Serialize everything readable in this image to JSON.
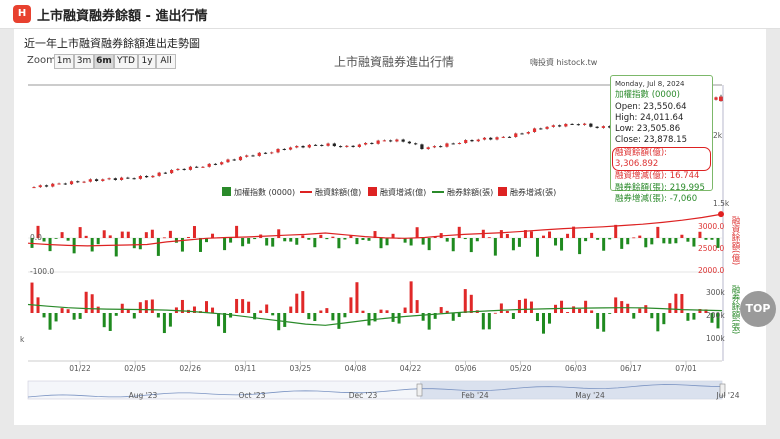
{
  "app": {
    "logo_text": "H",
    "title": "上市融資融券餘額 - 進出行情"
  },
  "section_title": "近一年上市融資融券餘額進出走勢圖",
  "zoom": {
    "label": "Zoom",
    "buttons": [
      "1m",
      "3m",
      "6m",
      "YTD",
      "1y",
      "All"
    ],
    "selected": "6m"
  },
  "chart_title": "上市融資融券進出行情",
  "credit": "嗨投資 histock.tw",
  "tooltip": {
    "date": "Monday, Jul 8, 2024",
    "series_name": "加權指數 (0000)",
    "open": "Open: 23,550.64",
    "high": "High: 24,011.64",
    "low": "Low: 23,505.86",
    "close": "Close: 23,878.15",
    "margin_balance": "融資餘額(億): 3,306.892",
    "margin_change": "融資增減(億): 16.744",
    "short_balance": "融券餘額(張): 219,995",
    "short_change": "融券增減(張): -7,060"
  },
  "legend": [
    {
      "label": "加權指數 (0000)",
      "kind": "box",
      "color": "#2a8a2a"
    },
    {
      "label": "融資餘額(億)",
      "kind": "line",
      "color": "#d22"
    },
    {
      "label": "融資增減(億)",
      "kind": "box",
      "color": "#d22"
    },
    {
      "label": "融券餘額(張)",
      "kind": "line",
      "color": "#2a8a2a"
    },
    {
      "label": "融券增減(張)",
      "kind": "box",
      "color": "#d22"
    }
  ],
  "axis_labels": {
    "price_right": [
      "2k",
      "1.5k"
    ],
    "margin_left": [
      "0.0",
      "-100.0"
    ],
    "margin_right": [
      "3000.0",
      "2500.0",
      "2000.0"
    ],
    "margin_title": "融資餘額(億)",
    "short_left": "k",
    "short_right": [
      "300k",
      "200k",
      "100k"
    ],
    "short_title": "融券餘額(張)"
  },
  "x_ticks": [
    "01/22",
    "02/05",
    "02/26",
    "03/11",
    "03/25",
    "04/08",
    "04/22",
    "05/06",
    "05/20",
    "06/03",
    "06/17",
    "07/01"
  ],
  "navigator_ticks": [
    "Aug '23",
    "Oct '23",
    "Dec '23",
    "Feb '24",
    "May '24",
    "Jul '24"
  ],
  "top_button": "TOP",
  "chart_data": {
    "type": "candlestick-combo",
    "x_range": [
      "2024-01-10",
      "2024-07-08"
    ],
    "last_point": {
      "date": "2024-07-08",
      "open": 23550.64,
      "high": 24011.64,
      "low": 23505.86,
      "close": 23878.15,
      "margin_balance": 3306.892,
      "margin_change": 16.744,
      "short_balance": 219995,
      "short_change": -7060
    },
    "index_close_trend": [
      17300,
      17500,
      17650,
      17800,
      17900,
      17950,
      18100,
      18500,
      18700,
      18900,
      19250,
      19600,
      19800,
      20150,
      20300,
      20400,
      20200,
      20450,
      20700,
      20650,
      20100,
      20350,
      20600,
      20800,
      20900,
      21200,
      21600,
      21800,
      21900,
      21600,
      21800,
      22300,
      22650,
      22900,
      23200,
      23878
    ],
    "margin_balance_trend": [
      2650,
      2620,
      2600,
      2590,
      2600,
      2610,
      2620,
      2680,
      2720,
      2760,
      2780,
      2790,
      2810,
      2830,
      2850,
      2880,
      2840,
      2800,
      2770,
      2760,
      2780,
      2820,
      2850,
      2870,
      2890,
      2920,
      2950,
      2980,
      3000,
      3020,
      3050,
      3080,
      3120,
      3170,
      3230,
      3307
    ],
    "short_balance_trend": [
      245000,
      238000,
      232000,
      228000,
      226000,
      225000,
      224000,
      222000,
      218000,
      212000,
      205000,
      195000,
      185000,
      175000,
      165000,
      160000,
      170000,
      180000,
      188000,
      196000,
      202000,
      208000,
      214000,
      218000,
      222000,
      225000,
      227000,
      229000,
      230000,
      231000,
      232000,
      231000,
      228000,
      224000,
      222000,
      220000
    ]
  }
}
